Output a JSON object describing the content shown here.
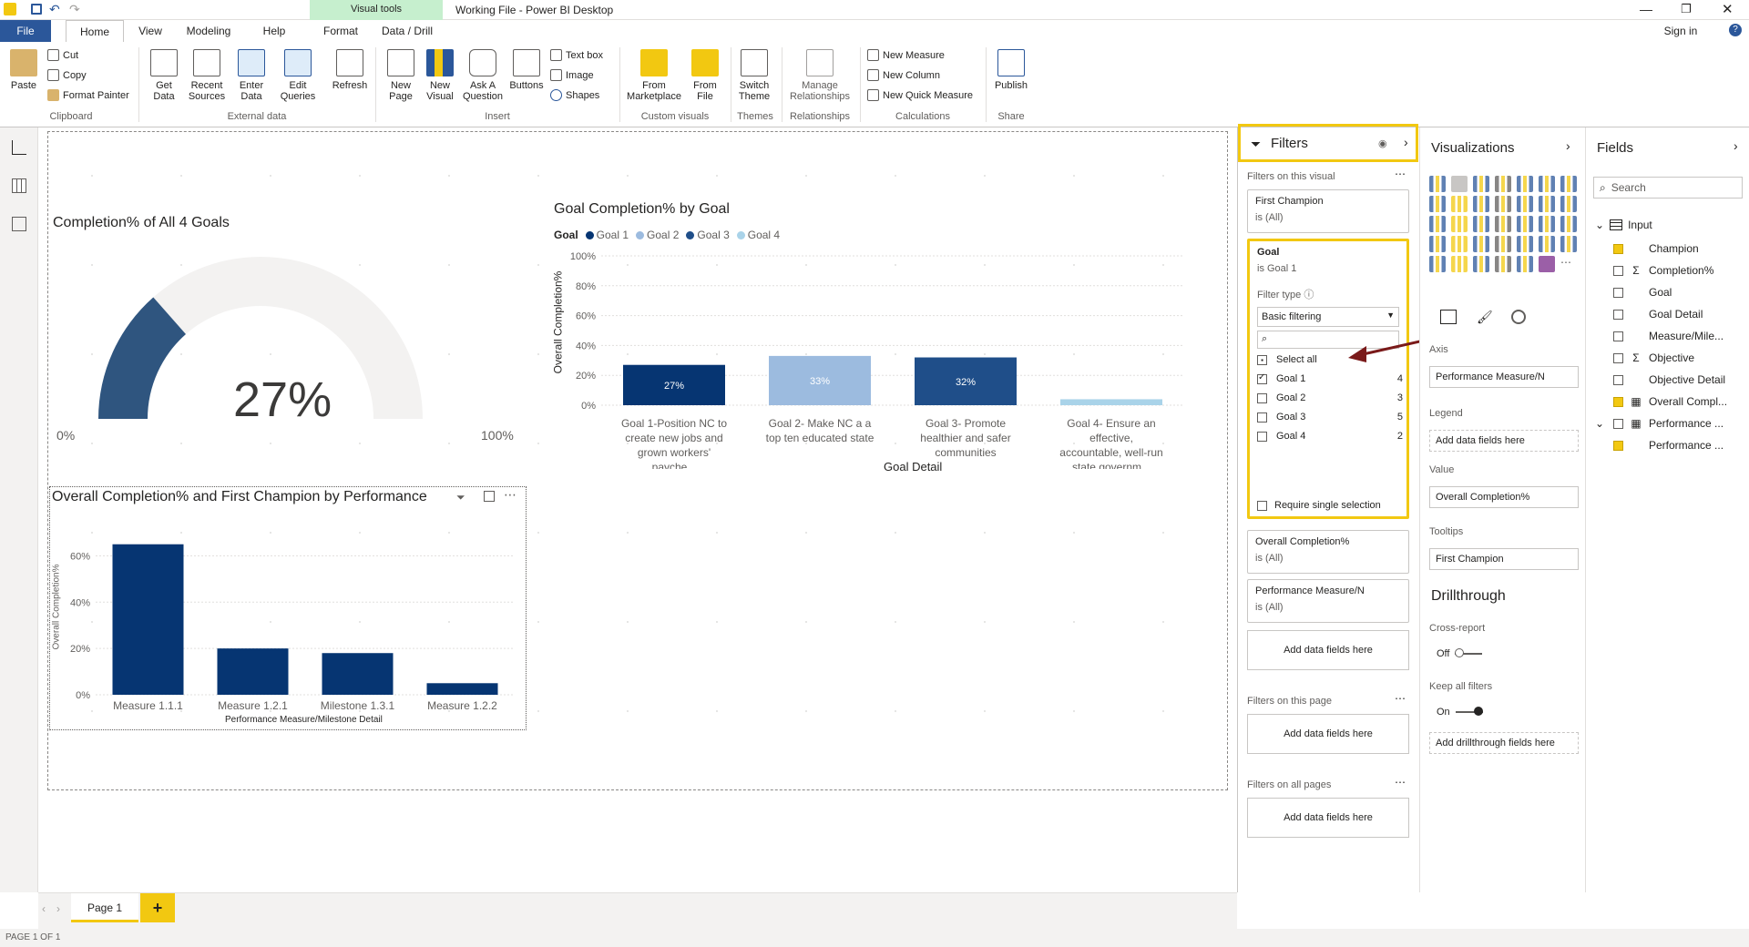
{
  "window": {
    "title": "Working File - Power BI Desktop",
    "context_tab": "Visual tools",
    "sign_in": "Sign in"
  },
  "tabs": [
    "File",
    "Home",
    "View",
    "Modeling",
    "Help",
    "Format",
    "Data / Drill"
  ],
  "ribbon": {
    "clipboard": {
      "paste": "Paste",
      "cut": "Cut",
      "copy": "Copy",
      "format_painter": "Format Painter",
      "group": "Clipboard"
    },
    "external": {
      "get_data": "Get Data",
      "recent_sources": "Recent Sources",
      "enter_data": "Enter Data",
      "edit_queries": "Edit Queries",
      "refresh": "Refresh",
      "group": "External data"
    },
    "insert": {
      "new_page": "New Page",
      "new_visual": "New Visual",
      "ask": "Ask A Question",
      "buttons": "Buttons",
      "text_box": "Text box",
      "image": "Image",
      "shapes": "Shapes",
      "group": "Insert"
    },
    "custom": {
      "marketplace": "From Marketplace",
      "file": "From File",
      "group": "Custom visuals"
    },
    "themes": {
      "switch": "Switch Theme",
      "group": "Themes"
    },
    "relationships": {
      "manage": "Manage Relationships",
      "group": "Relationships"
    },
    "calculations": {
      "new_measure": "New Measure",
      "new_column": "New Column",
      "new_quick_measure": "New Quick Measure",
      "group": "Calculations"
    },
    "share": {
      "publish": "Publish",
      "group": "Share"
    }
  },
  "gauge": {
    "title": "Completion% of All 4 Goals",
    "value_label": "27%",
    "value": 0.27,
    "min_label": "0%",
    "max_label": "100%"
  },
  "goal_chart": {
    "title": "Goal Completion% by Goal",
    "legend_title": "Goal",
    "ylabel": "Overall Completion%",
    "xlabel": "Goal Detail",
    "yticks": [
      "100%",
      "80%",
      "60%",
      "40%",
      "20%",
      "0%"
    ]
  },
  "perf_chart": {
    "title": "Overall Completion% and First Champion by Performance",
    "ylabel": "Overall Completion%",
    "xlabel": "Performance Measure/Milestone Detail",
    "yticks": [
      "60%",
      "40%",
      "20%",
      "0%"
    ]
  },
  "chart_data": [
    {
      "type": "bar",
      "title": "Goal Completion% by Goal",
      "categories": [
        "Goal 1-Position NC to create new jobs and grown workers' payche...",
        "Goal 2- Make NC a a top ten educated state",
        "Goal 3- Promote healthier and safer communities",
        "Goal 4- Ensure an effective, accountable, well-run state governm..."
      ],
      "values": [
        27,
        33,
        32,
        4
      ],
      "data_labels": [
        "27%",
        "33%",
        "32%",
        ""
      ],
      "series": [
        {
          "name": "Goal 1",
          "color": "#063572"
        },
        {
          "name": "Goal 2",
          "color": "#9cbbdf"
        },
        {
          "name": "Goal 3",
          "color": "#1f4e89"
        },
        {
          "name": "Goal 4",
          "color": "#a9d3e9"
        }
      ],
      "xlabel": "Goal Detail",
      "ylabel": "Overall Completion%",
      "ylim": [
        0,
        100
      ]
    },
    {
      "type": "bar",
      "title": "Overall Completion% and First Champion by Performance",
      "categories": [
        "Measure 1.1.1",
        "Measure 1.2.1",
        "Milestone 1.3.1",
        "Measure 1.2.2"
      ],
      "values": [
        65,
        20,
        18,
        5
      ],
      "color": "#063572",
      "xlabel": "Performance Measure/Milestone Detail",
      "ylabel": "Overall Completion%",
      "ylim": [
        0,
        70
      ]
    }
  ],
  "filters": {
    "title": "Filters",
    "on_visual": "Filters on this visual",
    "first_champion": {
      "name": "First Champion",
      "value": "is (All)"
    },
    "goal": {
      "name": "Goal",
      "value": "is Goal 1",
      "filter_type_label": "Filter type",
      "filter_type": "Basic filtering",
      "select_all": "Select all",
      "items": [
        {
          "label": "Goal 1",
          "count": "4",
          "checked": true
        },
        {
          "label": "Goal 2",
          "count": "3"
        },
        {
          "label": "Goal 3",
          "count": "5"
        },
        {
          "label": "Goal 4",
          "count": "2"
        }
      ],
      "require_single": "Require single selection"
    },
    "overall": {
      "name": "Overall Completion%",
      "value": "is (All)"
    },
    "perf": {
      "name": "Performance Measure/N",
      "value": "is (All)"
    },
    "add": "Add data fields here",
    "on_page": "Filters on this page",
    "on_all": "Filters on all pages"
  },
  "viz": {
    "title": "Visualizations",
    "axis": "Axis",
    "axis_field": "Performance Measure/N",
    "legend": "Legend",
    "add": "Add data fields here",
    "value": "Value",
    "value_field": "Overall Completion%",
    "tooltips": "Tooltips",
    "tooltip_field": "First Champion",
    "drill": "Drillthrough",
    "cross": "Cross-report",
    "off": "Off",
    "keep": "Keep all filters",
    "on": "On",
    "add_drill": "Add drillthrough fields here"
  },
  "fields": {
    "title": "Fields",
    "search": "Search",
    "table": "Input",
    "items": [
      "Champion",
      "Completion%",
      "Goal",
      "Goal Detail",
      "Measure/Mile...",
      "Objective",
      "Objective Detail",
      "Overall Compl...",
      "Performance ...",
      "Performance ..."
    ]
  },
  "page": {
    "tab": "Page 1",
    "add": "+",
    "status": "PAGE 1 OF 1"
  }
}
